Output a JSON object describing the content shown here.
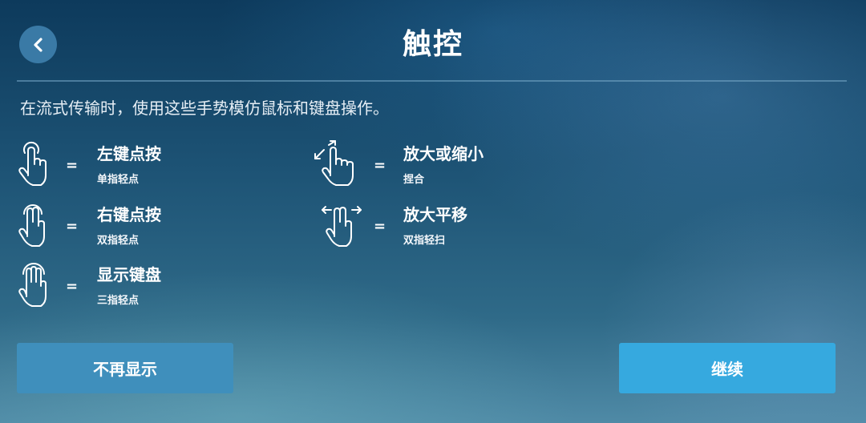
{
  "header": {
    "title": "触控"
  },
  "description": "在流式传输时，使用这些手势模仿鼠标和键盘操作。",
  "equals_sign": "=",
  "gestures": [
    {
      "label": "左键点按",
      "sub": "单指轻点",
      "icon": "one-finger-tap-icon"
    },
    {
      "label": "右键点按",
      "sub": "双指轻点",
      "icon": "two-finger-tap-icon"
    },
    {
      "label": "显示键盘",
      "sub": "三指轻点",
      "icon": "three-finger-tap-icon"
    },
    {
      "label": "放大或缩小",
      "sub": "捏合",
      "icon": "pinch-zoom-icon"
    },
    {
      "label": "放大平移",
      "sub": "双指轻扫",
      "icon": "two-finger-swipe-icon"
    }
  ],
  "buttons": {
    "dont_show": "不再显示",
    "continue": "继续"
  },
  "colors": {
    "back_button": "#3a7aa6",
    "dont_show_button": "#3f8fbc",
    "continue_button": "#36a9df"
  }
}
